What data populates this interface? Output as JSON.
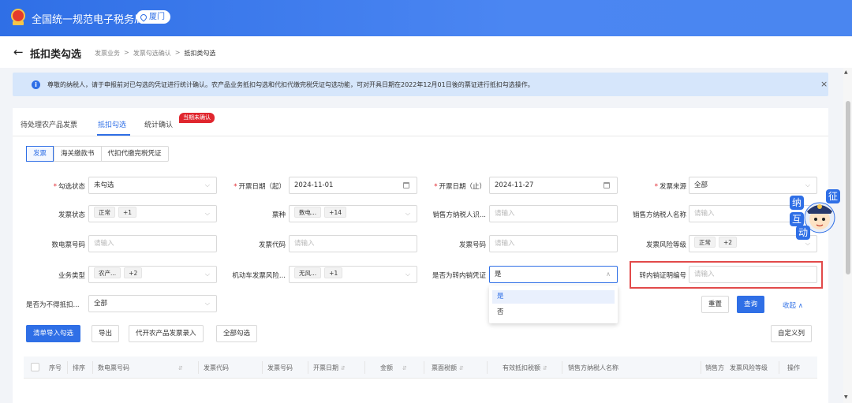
{
  "header": {
    "app_title": "全国统一规范电子税务局",
    "location": "厦门"
  },
  "breadcrumb": {
    "page_title": "抵扣类勾选",
    "items": [
      "发票业务",
      "发票勾选确认",
      "抵扣类勾选"
    ],
    "separator": ">"
  },
  "notice": {
    "text": "尊敬的纳税人，请于申报前对已勾选的凭证进行统计确认。农产品业务抵扣勾选和代扣代缴完税凭证勾选功能，可对开具日期在2022年12月01日後的票证进行抵扣勾选操作。",
    "close": "×"
  },
  "tabs": [
    {
      "label": "待处理农产品发票",
      "active": false
    },
    {
      "label": "抵扣勾选",
      "active": true
    },
    {
      "label": "统计确认",
      "active": false,
      "badge": "当期未确认"
    }
  ],
  "segments": [
    "发票",
    "海关缴款书",
    "代扣代缴完税凭证"
  ],
  "form": {
    "check_status": {
      "label": "勾选状态",
      "value": "未勾选"
    },
    "date_from": {
      "label": "开票日期（起）",
      "value": "2024-11-01"
    },
    "date_to": {
      "label": "开票日期（止）",
      "value": "2024-11-27"
    },
    "invoice_source": {
      "label": "发票来源",
      "value": "全部"
    },
    "invoice_status": {
      "label": "发票状态",
      "tag": "正常",
      "more": "+1"
    },
    "ticket_type": {
      "label": "票种",
      "tag": "数电...",
      "more": "+14"
    },
    "seller_tax_id": {
      "label": "销售方纳税人识...",
      "placeholder": "请输入"
    },
    "seller_name": {
      "label": "销售方纳税人名称",
      "placeholder": "请输入"
    },
    "digital_invoice_no": {
      "label": "数电票号码",
      "placeholder": "请输入"
    },
    "invoice_code": {
      "label": "发票代码",
      "placeholder": "请输入"
    },
    "invoice_no": {
      "label": "发票号码",
      "placeholder": "请输入"
    },
    "risk_level": {
      "label": "发票风险等级",
      "tag": "正常",
      "more": "+2"
    },
    "business_type": {
      "label": "业务类型",
      "tag": "农产...",
      "more": "+2"
    },
    "vehicle_risk": {
      "label": "机动车发票风险...",
      "tag": "无风...",
      "more": "+1"
    },
    "is_transfer": {
      "label": "是否为转内销凭证",
      "value": "是"
    },
    "transfer_cert_no": {
      "label": "转内销证明编号",
      "placeholder": "请输入"
    },
    "non_deductible": {
      "label": "是否为不得抵扣...",
      "value": "全部"
    }
  },
  "dropdown": {
    "options": [
      "是",
      "否"
    ],
    "selected": "是"
  },
  "actions": {
    "reset": "重置",
    "query": "查询",
    "collapse": "收起 ∧"
  },
  "toolbar": {
    "import": "清单导入勾选",
    "export": "导出",
    "agri_entry": "代开农产品发票录入",
    "select_all": "全部勾选",
    "custom_columns": "自定义列"
  },
  "table": {
    "headers": [
      "序号",
      "排序",
      "数电票号码",
      "发票代码",
      "发票号码",
      "开票日期",
      "金额",
      "票面税额",
      "有效抵扣税额",
      "销售方纳税人名称",
      "销售方",
      "发票风险等级",
      "操作"
    ]
  },
  "mascot": {
    "chars": [
      "征",
      "纳",
      "互",
      "动"
    ]
  },
  "colors": {
    "primary": "#2f6fe6",
    "danger": "#e0262e",
    "highlight": "#e24a4a"
  }
}
